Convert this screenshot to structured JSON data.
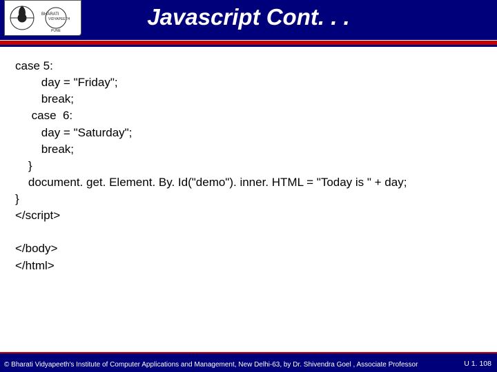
{
  "header": {
    "title": "Javascript Cont. . ."
  },
  "logo": {
    "left_text": "BHARATI",
    "right_text": "VIDYAPEETH",
    "bottom_text": "PUNE"
  },
  "code": {
    "lines": [
      "case 5:",
      "        day = \"Friday\";",
      "        break;",
      "     case  6:",
      "        day = \"Saturday\";",
      "        break;",
      "    }",
      "    document. get. Element. By. Id(\"demo\"). inner. HTML = \"Today is \" + day;",
      "}",
      "</script>",
      "",
      "</body>",
      "</html>"
    ]
  },
  "footer": {
    "copyright": "© Bharati Vidyapeeth's Institute of Computer Applications and Management, New Delhi-63, by Dr. Shivendra Goel , Associate Professor",
    "page": "U 1.  108"
  }
}
